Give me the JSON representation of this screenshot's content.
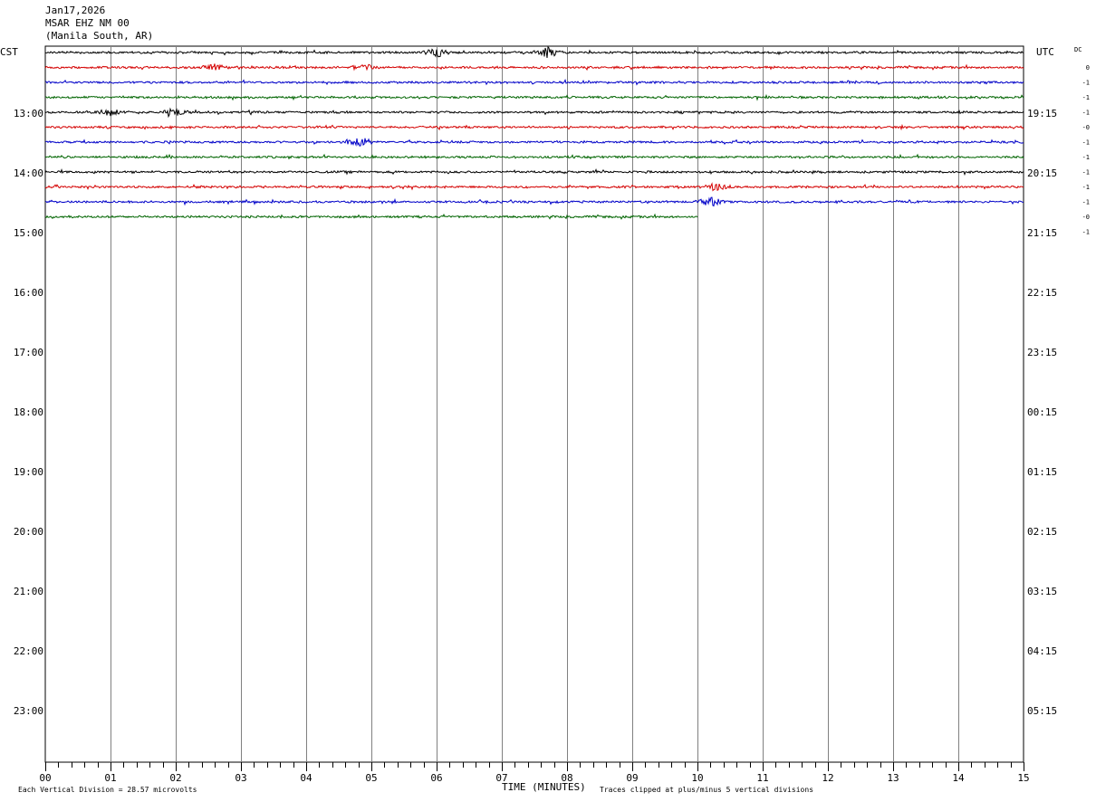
{
  "header": {
    "date": "Jan17,2026",
    "station": "MSAR EHZ NM 00",
    "location": "(Manila South, AR)"
  },
  "left_tz": "CST",
  "right_tz": "UTC",
  "dc_label": "DC",
  "footer": {
    "scale_note": "Each Vertical Division =   28.57 microvolts",
    "axis_title": "TIME (MINUTES)",
    "clip_note": "Traces clipped at plus/minus 5 vertical divisions"
  },
  "colors": {
    "trace": [
      "#000000",
      "#d40000",
      "#0000c8",
      "#006400"
    ],
    "grid": "#808080"
  },
  "chart_data": {
    "type": "line",
    "title": "MSAR EHZ NM 00",
    "xlabel": "TIME (MINUTES)",
    "ylabel": "",
    "xlim": [
      0,
      15
    ],
    "x_ticks": [
      "00",
      "01",
      "02",
      "03",
      "04",
      "05",
      "06",
      "07",
      "08",
      "09",
      "10",
      "11",
      "12",
      "13",
      "14",
      "15"
    ],
    "left_hour_labels": [
      "13:00",
      "14:00",
      "15:00",
      "16:00",
      "17:00",
      "18:00",
      "19:00",
      "20:00",
      "21:00",
      "22:00",
      "23:00"
    ],
    "right_hour_labels": [
      "19:15",
      "20:15",
      "21:15",
      "22:15",
      "23:15",
      "00:15",
      "01:15",
      "02:15",
      "03:15",
      "04:15",
      "05:15"
    ],
    "traces_per_hour": 4,
    "dc_offsets": [
      "0",
      "-1",
      "-1",
      "-1",
      "-0",
      "-1",
      "-1",
      "-1",
      "-1",
      "-1",
      "-0",
      "-1"
    ],
    "last_trace_end_minute": 10,
    "events": [
      {
        "trace": 0,
        "minute": 6.0,
        "amp": 1.0
      },
      {
        "trace": 0,
        "minute": 7.7,
        "amp": 1.2
      },
      {
        "trace": 1,
        "minute": 2.6,
        "amp": 0.8
      },
      {
        "trace": 1,
        "minute": 4.9,
        "amp": 0.7
      },
      {
        "trace": 4,
        "minute": 1.0,
        "amp": 0.9
      },
      {
        "trace": 4,
        "minute": 2.0,
        "amp": 0.9
      },
      {
        "trace": 6,
        "minute": 4.8,
        "amp": 1.4
      },
      {
        "trace": 9,
        "minute": 10.3,
        "amp": 0.9
      },
      {
        "trace": 10,
        "minute": 10.2,
        "amp": 1.0
      }
    ]
  }
}
